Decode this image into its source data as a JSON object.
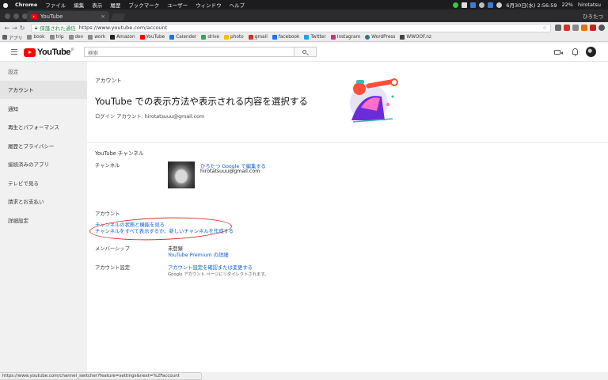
{
  "menubar": {
    "app": "Chrome",
    "items": [
      "ファイル",
      "編集",
      "表示",
      "履歴",
      "ブックマーク",
      "ユーザー",
      "ウィンドウ",
      "ヘルプ"
    ],
    "datetime": "6月30日(水) 2:56:59",
    "battery": "22%",
    "user": "hirotatsu"
  },
  "tab": {
    "title": "YouTube",
    "close": "×"
  },
  "window_profile": "ひろたつ",
  "omnibox": {
    "secure_label": "保護された通信",
    "url": "https://www.youtube.com/account"
  },
  "bookmarks": [
    "アプリ",
    "book",
    "trip",
    "dev",
    "work",
    "Amazon",
    "YouTube",
    "Calender",
    "drive",
    "photo",
    "gmail",
    "facebook",
    "Twitter",
    "Instagram",
    "WordPress",
    "WWOOF.nz"
  ],
  "yt_header": {
    "logo_text": "YouTube",
    "logo_region": "JP",
    "search_placeholder": "検索"
  },
  "sidebar": {
    "title": "設定",
    "items": [
      "アカウント",
      "通知",
      "再生とパフォーマンス",
      "履歴とプライバシー",
      "接続済みのアプリ",
      "テレビで見る",
      "請求とお支払い",
      "詳細設定"
    ],
    "active_index": 0
  },
  "main": {
    "section_label": "アカウント",
    "title": "YouTube での表示方法や表示される内容を選択する",
    "login_line": "ログイン アカウント: hirotatsuuu@gmail.com",
    "channel_section": "YouTube チャンネル",
    "channel_label": "チャンネル",
    "channel_edit_link": "ひろたつ Google で編集する",
    "channel_email": "hirotatsuuu@gmail.com",
    "account_section": "アカウント",
    "status_link": "チャンネルの状態と機能を見る",
    "switch_link": "チャンネルをすべて表示するか、新しいチャンネルを作成する",
    "membership_label": "メンバーシップ",
    "membership_value": "未登録",
    "premium_link": "YouTube Premium の詳細",
    "account_settings_label": "アカウント設定",
    "account_settings_link": "アカウント設定を確認または変更する",
    "account_settings_note": "Google アカウント ページにリダイレクトされます。"
  },
  "status_url": "https://www.youtube.com/channel_switcher?feature=settings&next=%2Faccount",
  "colors": {
    "accent_red": "#ff0000",
    "link_blue": "#065fd4",
    "annotation_red": "#d8332b"
  }
}
